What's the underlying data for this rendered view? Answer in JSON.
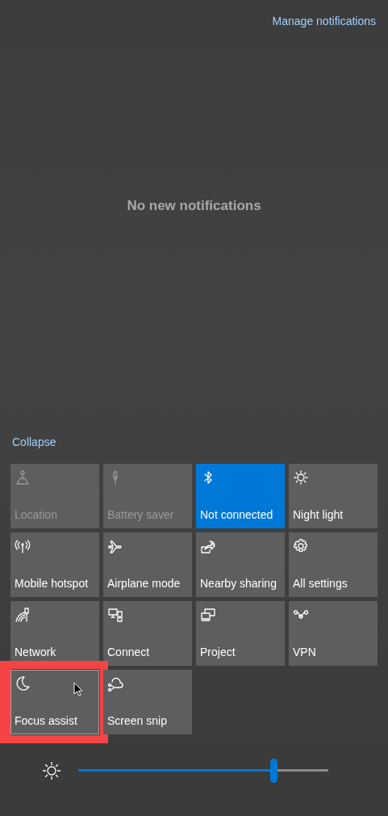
{
  "manage_link": "Manage notifications",
  "empty_message": "No new notifications",
  "collapse_link": "Collapse",
  "tiles": [
    {
      "label": "Location",
      "on": false,
      "disabled": true,
      "highlighted": false
    },
    {
      "label": "Battery saver",
      "on": false,
      "disabled": true,
      "highlighted": false
    },
    {
      "label": "Not connected",
      "on": true,
      "disabled": false,
      "highlighted": false
    },
    {
      "label": "Night light",
      "on": false,
      "disabled": false,
      "highlighted": false
    },
    {
      "label": "Mobile hotspot",
      "on": false,
      "disabled": false,
      "highlighted": false
    },
    {
      "label": "Airplane mode",
      "on": false,
      "disabled": false,
      "highlighted": false
    },
    {
      "label": "Nearby sharing",
      "on": false,
      "disabled": false,
      "highlighted": false
    },
    {
      "label": "All settings",
      "on": false,
      "disabled": false,
      "highlighted": false
    },
    {
      "label": "Network",
      "on": false,
      "disabled": false,
      "highlighted": false
    },
    {
      "label": "Connect",
      "on": false,
      "disabled": false,
      "highlighted": false
    },
    {
      "label": "Project",
      "on": false,
      "disabled": false,
      "highlighted": false
    },
    {
      "label": "VPN",
      "on": false,
      "disabled": false,
      "highlighted": false
    },
    {
      "label": "Focus assist",
      "on": false,
      "disabled": false,
      "highlighted": true
    },
    {
      "label": "Screen snip",
      "on": false,
      "disabled": false,
      "highlighted": false
    }
  ],
  "brightness": {
    "level": 0.79
  }
}
